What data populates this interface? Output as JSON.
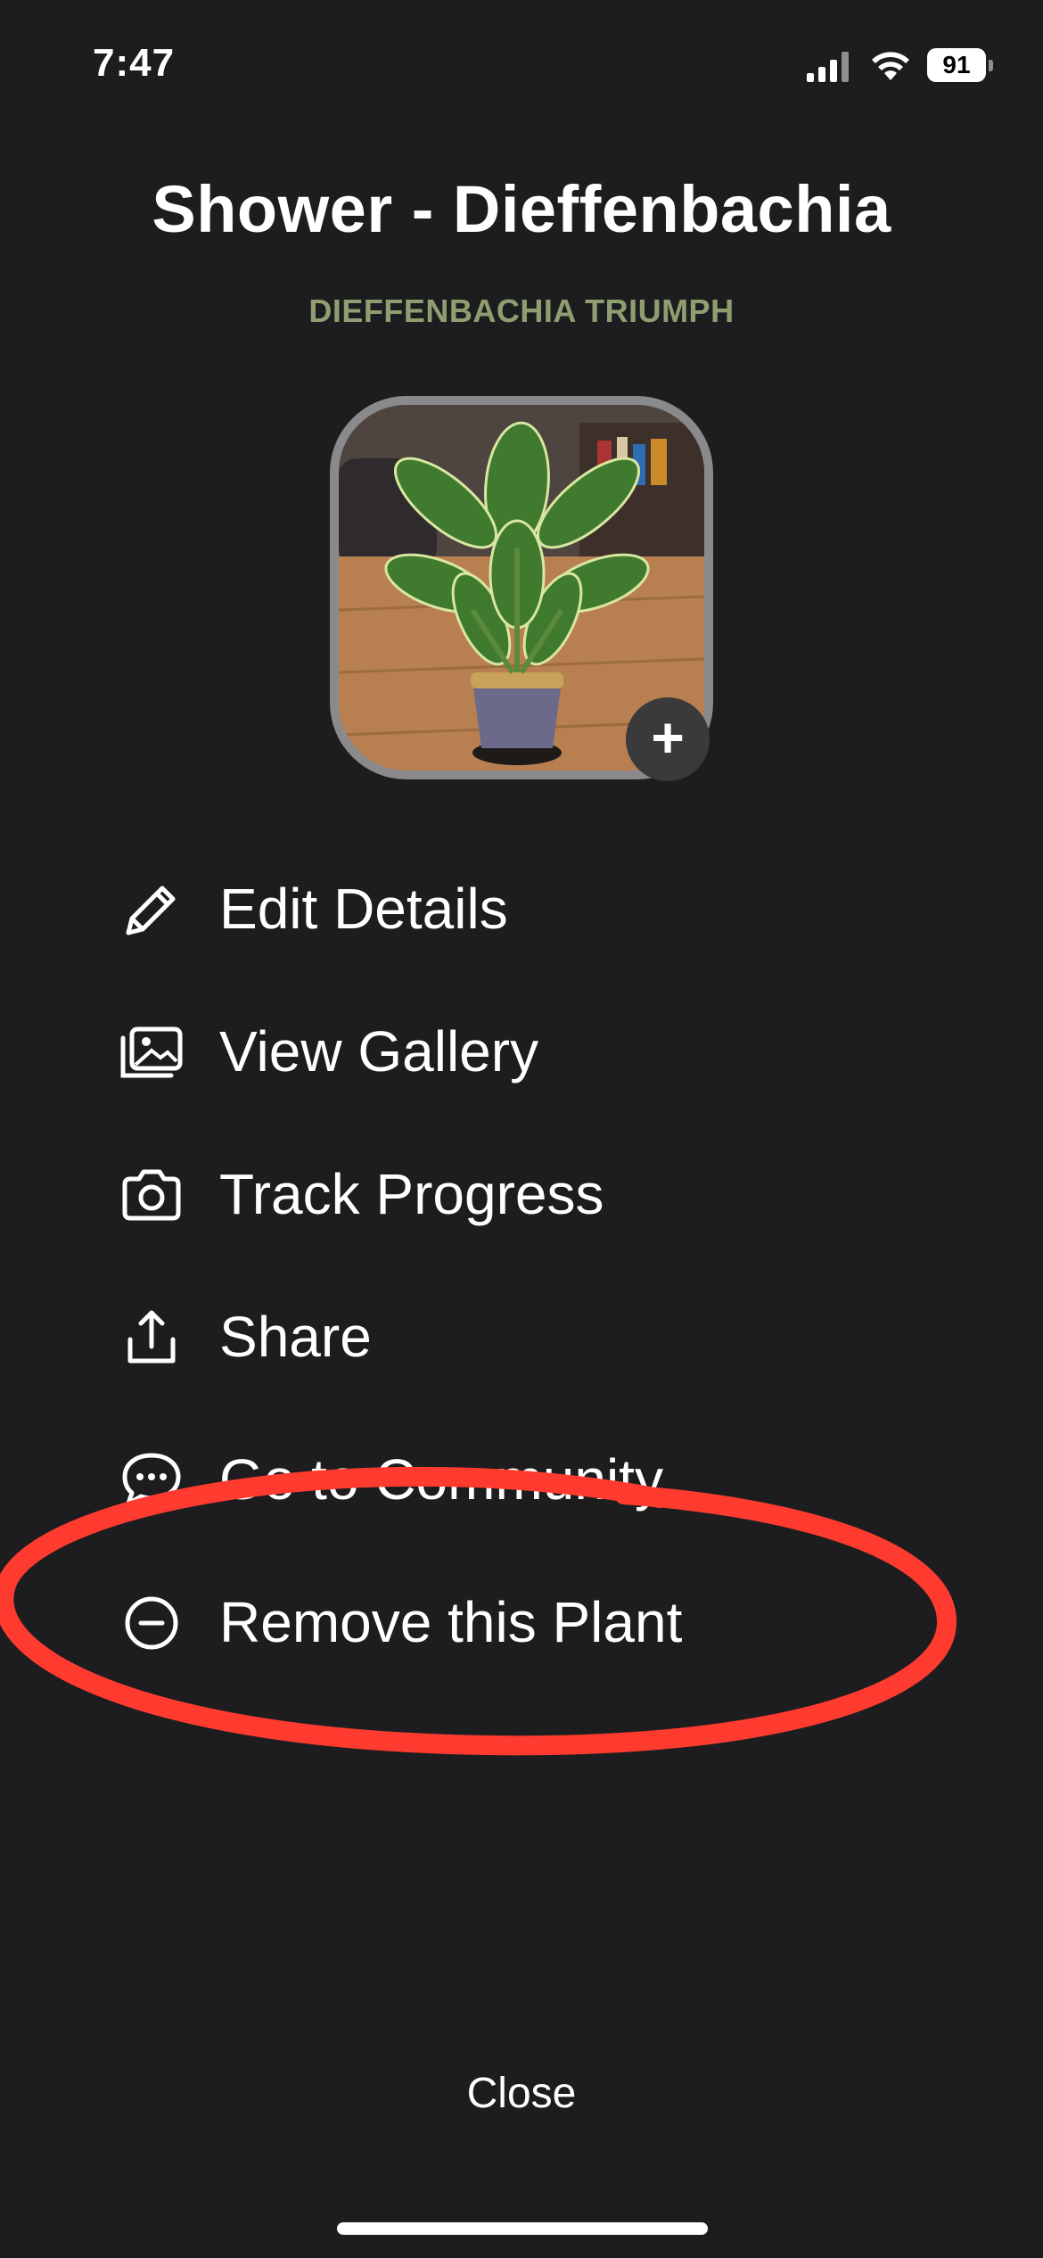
{
  "status_bar": {
    "time": "7:47",
    "battery": "91"
  },
  "header": {
    "title": "Shower - Dieffenbachia",
    "subtitle": "DIEFFENBACHIA TRIUMPH"
  },
  "photo": {
    "add_label": "+"
  },
  "menu": {
    "items": [
      {
        "label": "Edit Details",
        "icon": "pencil-icon"
      },
      {
        "label": "View Gallery",
        "icon": "gallery-icon"
      },
      {
        "label": "Track Progress",
        "icon": "camera-icon"
      },
      {
        "label": "Share",
        "icon": "share-icon"
      },
      {
        "label": "Go to Community",
        "icon": "chat-bubble-icon"
      },
      {
        "label": "Remove this Plant",
        "icon": "minus-circle-icon"
      }
    ]
  },
  "footer": {
    "close_label": "Close"
  },
  "colors": {
    "background": "#1d1d1f",
    "subtitle": "#8e9e71",
    "annotation": "#ff3b30"
  }
}
